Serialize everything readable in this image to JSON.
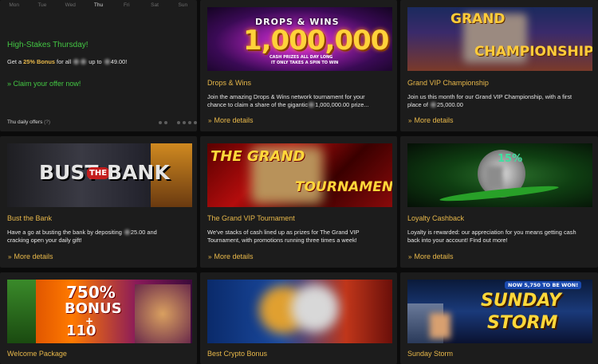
{
  "offer_day": {
    "days": [
      "Mon",
      "Tue",
      "Wed",
      "Thu",
      "Fri",
      "Sat",
      "Sun"
    ],
    "title": "High-Stakes Thursday!",
    "subtitle_pre": "Get a ",
    "subtitle_bonus": "25% Bonus",
    "subtitle_mid": " for all ",
    "subtitle_end": " up to ",
    "subtitle_amount": "49.00!",
    "claim_label": "» Claim your offer now!",
    "footer_label": "Thu daily offers",
    "footer_info": "(?)"
  },
  "cards": [
    {
      "title": "Drops & Wins",
      "banner": {
        "line1": "DROPS & WINS",
        "line2": "1,000,000",
        "line3": "CASH PRIZES ALL DAY LONG",
        "line4": "IT ONLY TAKES A SPIN TO WIN"
      },
      "desc": [
        "Join the amazing Drops & Wins network tournament for your",
        "chance to claim a share of the gigantic",
        "1,000,000.00 prize..."
      ],
      "more": "More details"
    },
    {
      "title": "Grand VIP Championship",
      "banner": {
        "line1": "GRAND",
        "line2": "CHAMPIONSHIP"
      },
      "desc": [
        "Join us this month for our Grand VIP Championship, with a first",
        "place of",
        "25,000.00"
      ],
      "more": "More details"
    },
    {
      "title": "Bust the Bank",
      "banner": {
        "line1": "BUST",
        "line2": "THE",
        "line3": "BANK"
      },
      "desc": [
        "Have a go at busting the bank by depositing",
        "25.00 and",
        "cracking open your daily gift!"
      ],
      "more": "More details"
    },
    {
      "title": "The Grand VIP Tournament",
      "banner": {
        "line1": "THE GRAND",
        "line2": "TOURNAMENT"
      },
      "desc": [
        "We've stacks of cash lined up as prizes for The Grand VIP",
        "Tournament, with promotions running three times a week!"
      ],
      "more": "More details"
    },
    {
      "title": "Loyalty Cashback",
      "banner": {
        "line1": "15%"
      },
      "desc": [
        "Loyalty is rewarded: our appreciation for you means getting cash",
        "back into your account! Find out more!"
      ],
      "more": "More details"
    },
    {
      "title": "Welcome Package",
      "banner": {
        "line1": "750%",
        "line2": "BONUS",
        "line3": "+",
        "line4": "110"
      }
    },
    {
      "title": "Best Crypto Bonus"
    },
    {
      "title": "Sunday Storm",
      "banner": {
        "line1": "NOW 5,750 TO BE WON!",
        "line2": "SUNDAY",
        "line3": "STORM"
      }
    }
  ],
  "colors": {
    "accent_gold": "#e8b84a",
    "accent_green": "#43c743",
    "card_bg": "#1c1c1c",
    "page_bg": "#0b0b0b"
  },
  "icons": [
    "chevron-right-icon",
    "info-icon",
    "carousel-dot-icon"
  ]
}
